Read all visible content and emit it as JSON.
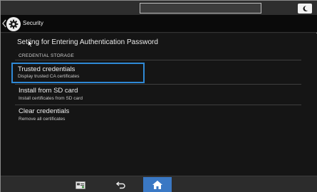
{
  "header": {
    "title": "Security"
  },
  "main": {
    "heading": "Setting for Entering Authentication Password",
    "section_label": "CREDENTIAL STORAGE",
    "items": [
      {
        "label": "Trusted credentials",
        "description": "Display trusted CA certificates",
        "selected": true
      },
      {
        "label": "Install from SD card",
        "description": "Install certificates from SD card",
        "selected": false
      },
      {
        "label": "Clear credentials",
        "description": "Remove all certificates",
        "selected": false
      }
    ]
  },
  "icons": {
    "status": "moon-icon",
    "title": "gear-icon",
    "back": "chevron-left-icon",
    "nav_apps": "app-list-icon",
    "nav_back": "undo-arrow-icon",
    "nav_home": "home-icon"
  },
  "colors": {
    "highlight": "#2f89d6",
    "home_button": "#3a78c4",
    "background": "#151515"
  }
}
